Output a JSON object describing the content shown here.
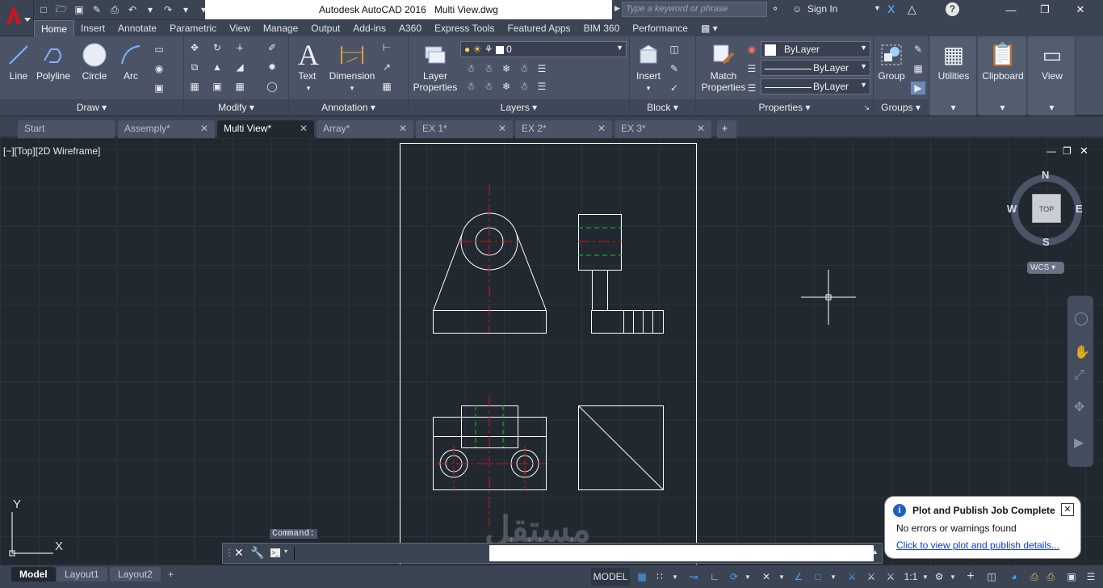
{
  "window": {
    "title": "Autodesk AutoCAD 2016",
    "filename": "Multi View.dwg",
    "search_placeholder": "Type a keyword or phrase",
    "sign_in": "Sign In"
  },
  "ribbon_tabs": [
    "Home",
    "Insert",
    "Annotate",
    "Parametric",
    "View",
    "Manage",
    "Output",
    "Add-ins",
    "A360",
    "Express Tools",
    "Featured Apps",
    "BIM 360",
    "Performance"
  ],
  "panels": {
    "draw": {
      "title": "Draw",
      "line": "Line",
      "polyline": "Polyline",
      "circle": "Circle",
      "arc": "Arc"
    },
    "modify": {
      "title": "Modify"
    },
    "annotation": {
      "title": "Annotation",
      "text": "Text",
      "dimension": "Dimension"
    },
    "layers": {
      "title": "Layers",
      "layer_properties_1": "Layer",
      "layer_properties_2": "Properties",
      "current_layer": "0"
    },
    "block": {
      "title": "Block",
      "insert": "Insert"
    },
    "properties": {
      "title": "Properties",
      "match_1": "Match",
      "match_2": "Properties",
      "color": "ByLayer",
      "linetype": "ByLayer",
      "lineweight": "ByLayer"
    },
    "groups": {
      "title": "Groups",
      "group": "Group"
    },
    "utilities": {
      "label": "Utilities"
    },
    "clipboard": {
      "label": "Clipboard"
    },
    "view": {
      "label": "View"
    }
  },
  "doc_tabs": [
    {
      "label": "Start",
      "active": false
    },
    {
      "label": "Assemply*",
      "active": false
    },
    {
      "label": "Multi View*",
      "active": true
    },
    {
      "label": "Array*",
      "active": false
    },
    {
      "label": "EX 1*",
      "active": false
    },
    {
      "label": "EX 2*",
      "active": false
    },
    {
      "label": "EX 3*",
      "active": false
    }
  ],
  "viewport": {
    "label": "[−][Top][2D Wireframe]",
    "viewcube": {
      "n": "N",
      "s": "S",
      "e": "E",
      "w": "W",
      "face": "TOP",
      "wcs": "WCS"
    },
    "ucs": {
      "x": "X",
      "y": "Y"
    }
  },
  "command": {
    "label": "Command:",
    "value": ""
  },
  "layout_tabs": [
    {
      "label": "Model",
      "active": true
    },
    {
      "label": "Layout1",
      "active": false
    },
    {
      "label": "Layout2",
      "active": false
    }
  ],
  "status": {
    "model": "MODEL",
    "scale": "1:1"
  },
  "notification": {
    "title": "Plot and Publish Job Complete",
    "message": "No errors or warnings found",
    "link": "Click to view plot and publish details..."
  },
  "colors": {
    "accent": "#c0181c",
    "drawing_line": "#ffffff",
    "center_line": "#d01818",
    "hidden_line": "#19c419"
  }
}
